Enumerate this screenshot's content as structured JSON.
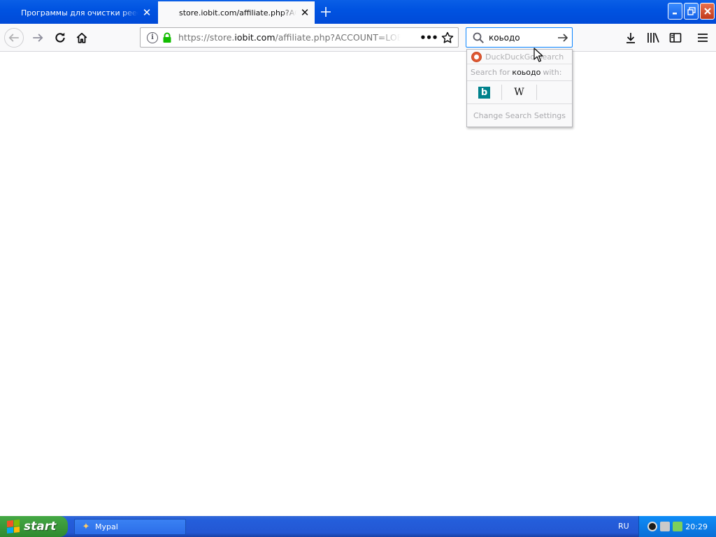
{
  "tabs": [
    {
      "label": "Программы для очистки реестр",
      "active": false
    },
    {
      "label": "store.iobit.com/affiliate.php?ACC",
      "active": true
    }
  ],
  "url": {
    "scheme": "https://store.",
    "host": "iobit.com",
    "rest": "/affiliate.php?ACCOUNT=LOBIT&",
    "security": "secure-connection"
  },
  "search": {
    "query": "коьодо",
    "engine_name": "DuckDuckGo Search",
    "search_for_prefix": "Search for",
    "search_for_suffix": "with:",
    "alt_engines": [
      "bing",
      "wikipedia"
    ],
    "settings_label": "Change Search Settings"
  },
  "taskbar": {
    "start_label": "start",
    "items": [
      {
        "label": "Mypal"
      }
    ],
    "language": "RU",
    "clock": "20:29"
  },
  "colors": {
    "accent": "#0a84ff",
    "titlebar": "#0053e1",
    "start_green": "#3c9b3c"
  }
}
